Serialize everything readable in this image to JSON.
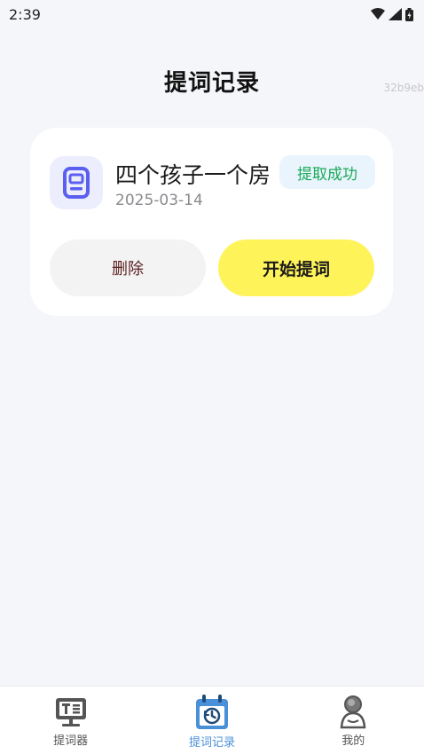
{
  "status_bar": {
    "time": "2:39"
  },
  "header": {
    "title": "提词记录",
    "debug_tag": "32b9eb"
  },
  "record": {
    "title": "四个孩子一个房",
    "date": "2025-03-14",
    "status": "提取成功",
    "delete_label": "删除",
    "start_label": "开始提词"
  },
  "tabs": [
    {
      "label": "提词器",
      "icon": "teleprompter-icon"
    },
    {
      "label": "提词记录",
      "icon": "history-calendar-icon"
    },
    {
      "label": "我的",
      "icon": "profile-icon"
    }
  ],
  "colors": {
    "accent_yellow": "#fff35a",
    "success_green": "#1aaa5a",
    "active_tab": "#4a90d9",
    "icon_purple": "#5b5ff0"
  }
}
